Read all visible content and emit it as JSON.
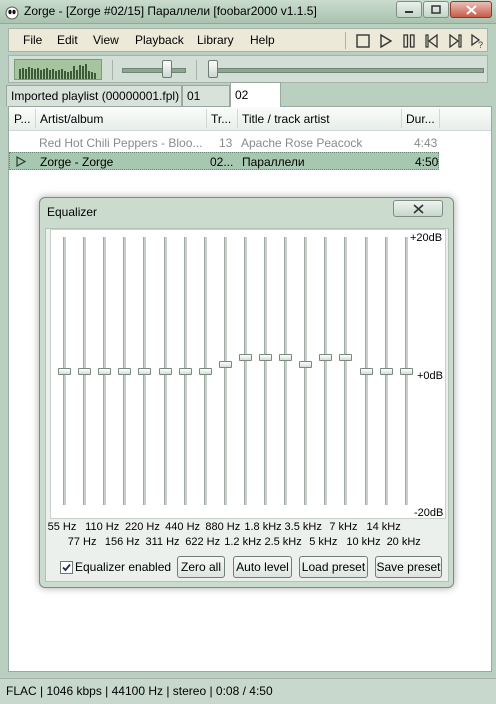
{
  "window": {
    "title": "Zorge - [Zorge #02/15] Параллели   [foobar2000 v1.1.5]"
  },
  "menu": [
    "File",
    "Edit",
    "View",
    "Playback",
    "Library",
    "Help"
  ],
  "toolbar": {
    "icons": [
      "stop-icon",
      "play-icon",
      "pause-icon",
      "previous-icon",
      "next-icon",
      "random-icon"
    ],
    "volume_level": 0.72,
    "seek_position": 0.03
  },
  "tabs": [
    "Imported playlist (00000001.fpl)",
    "01",
    "02"
  ],
  "active_tab": 2,
  "playlist": {
    "columns": [
      "P...",
      "Artist/album",
      "Tr...",
      "Title / track artist",
      "Dur..."
    ],
    "rows": [
      {
        "artist": "Red Hot Chili Peppers - Bloo...",
        "track": "13",
        "title": "Apache Rose Peacock",
        "duration": "4:43",
        "playing": false
      },
      {
        "artist": "Zorge - Zorge",
        "track": "02...",
        "title": "Параллели",
        "duration": "4:50",
        "playing": true
      }
    ]
  },
  "equalizer": {
    "title": "Equalizer",
    "db_labels": {
      "top": "+20dB",
      "mid": "+0dB",
      "bottom": "-20dB"
    },
    "bands": [
      {
        "freq": "55 Hz",
        "db": 0
      },
      {
        "freq": "77 Hz",
        "db": 0
      },
      {
        "freq": "110 Hz",
        "db": 0
      },
      {
        "freq": "156 Hz",
        "db": 0
      },
      {
        "freq": "220 Hz",
        "db": 0
      },
      {
        "freq": "311 Hz",
        "db": 0
      },
      {
        "freq": "440 Hz",
        "db": 0
      },
      {
        "freq": "622 Hz",
        "db": 0
      },
      {
        "freq": "880 Hz",
        "db": 1
      },
      {
        "freq": "1.2 kHz",
        "db": 2
      },
      {
        "freq": "1.8 kHz",
        "db": 2
      },
      {
        "freq": "2.5 kHz",
        "db": 2
      },
      {
        "freq": "3.5 kHz",
        "db": 1
      },
      {
        "freq": "5 kHz",
        "db": 2
      },
      {
        "freq": "7 kHz",
        "db": 2
      },
      {
        "freq": "10 kHz",
        "db": 0
      },
      {
        "freq": "14 kHz",
        "db": 0
      },
      {
        "freq": "20 kHz",
        "db": 0
      }
    ],
    "enabled_label": "Equalizer enabled",
    "enabled": true,
    "buttons": {
      "zero_all": "Zero all",
      "auto_level": "Auto level",
      "load_preset": "Load preset",
      "save_preset": "Save preset"
    }
  },
  "status": "FLAC | 1046 kbps | 44100 Hz | stereo | 0:08 / 4:50"
}
